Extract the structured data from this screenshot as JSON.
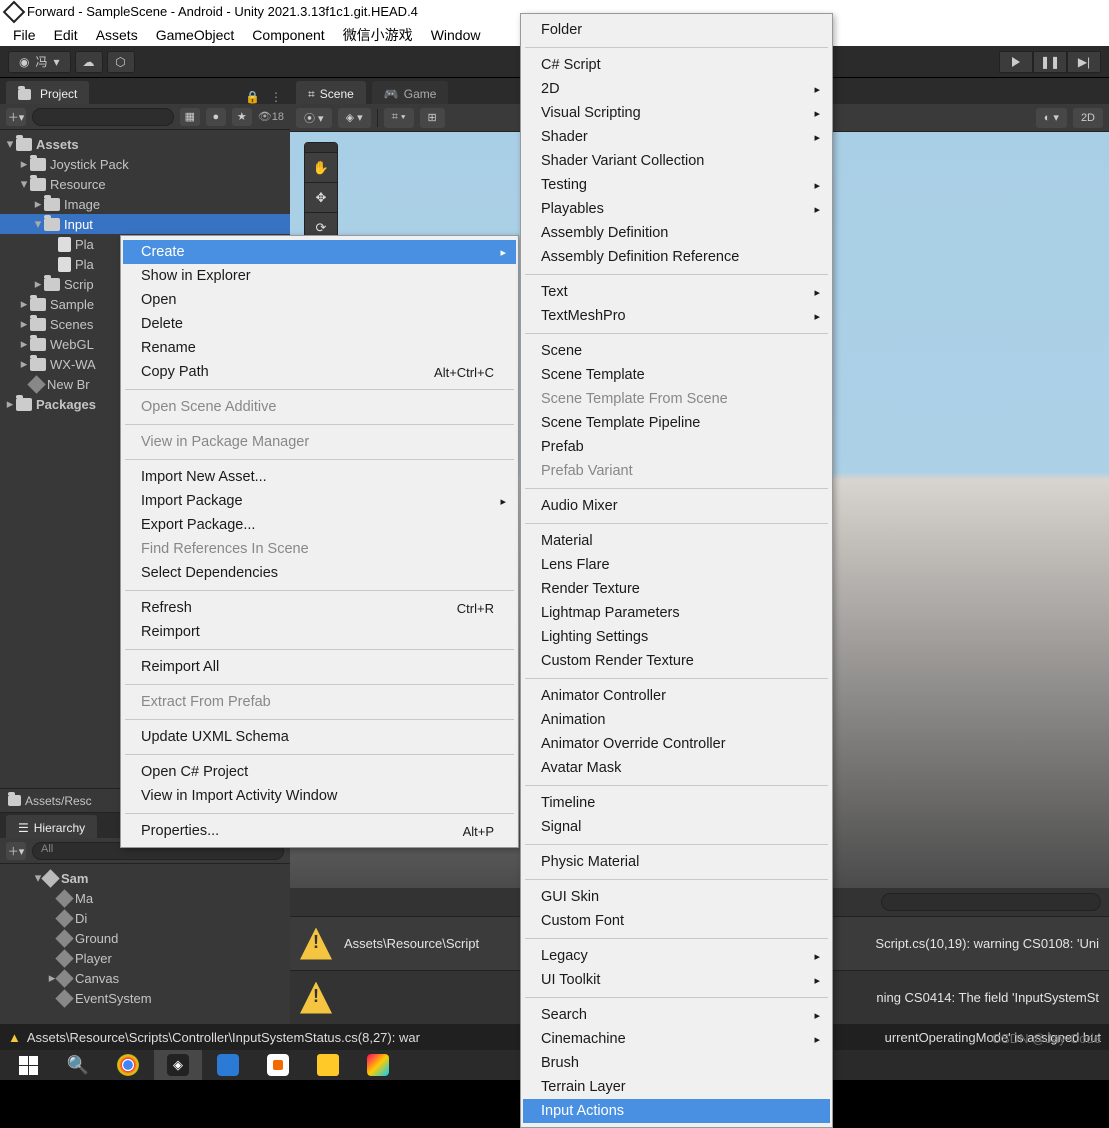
{
  "title": "Forward - SampleScene - Android - Unity 2021.3.13f1c1.git.HEAD.4",
  "menubar": [
    "File",
    "Edit",
    "Assets",
    "GameObject",
    "Component",
    "微信小游戏",
    "Window"
  ],
  "account": "冯",
  "play": {
    "play": "▶",
    "pause": "❚❚",
    "step": "▶|"
  },
  "projectTab": "Project",
  "visibilityCount": "18",
  "sceneTab": "Scene",
  "gameTab": "Game",
  "twoD": "2D",
  "tree": {
    "root": "Assets",
    "joystick": "Joystick Pack",
    "resource": "Resource",
    "image": "Image",
    "input": "Input",
    "pla1": "Pla",
    "pla2": "Pla",
    "scripts": "Scrip",
    "samples": "Sample",
    "scenes": "Scenes",
    "webgl": "WebGL",
    "wxwa": "WX-WA",
    "newbr": "New Br",
    "packages": "Packages"
  },
  "assetsPath": "Assets/Resc",
  "hierarchyTab": "Hierarchy",
  "hierarchySearch": "All",
  "hierarchy": {
    "scene": "Sam",
    "items": [
      "Ma",
      "Di",
      "Ground",
      "Player",
      "Canvas",
      "EventSystem"
    ]
  },
  "console": {
    "msg1": "Assets\\Resource\\Script",
    "msg1b": "Script.cs(10,19): warning CS0108: 'Uni",
    "msg2": "ning CS0414: The field 'InputSystemSt"
  },
  "status": "Assets\\Resource\\Scripts\\Controller\\InputSystemStatus.cs(8,27): war",
  "statusRight": "urrentOperatingMode' is assigned but",
  "watermark": "CSDN @Jay-Code",
  "ctx1": {
    "create": "Create",
    "showInExplorer": "Show in Explorer",
    "open": "Open",
    "del": "Delete",
    "rename": "Rename",
    "copyPath": "Copy Path",
    "copyPathSc": "Alt+Ctrl+C",
    "openSceneAdd": "Open Scene Additive",
    "viewInPkg": "View in Package Manager",
    "importAsset": "Import New Asset...",
    "importPackage": "Import Package",
    "exportPackage": "Export Package...",
    "findRefs": "Find References In Scene",
    "selectDeps": "Select Dependencies",
    "refresh": "Refresh",
    "refreshSc": "Ctrl+R",
    "reimport": "Reimport",
    "reimportAll": "Reimport All",
    "extract": "Extract From Prefab",
    "updateUxml": "Update UXML Schema",
    "openCs": "Open C# Project",
    "viewImport": "View in Import Activity Window",
    "properties": "Properties...",
    "propertiesSc": "Alt+P"
  },
  "ctx2": {
    "folder": "Folder",
    "csScript": "C# Script",
    "twoD": "2D",
    "visualScripting": "Visual Scripting",
    "shader": "Shader",
    "shaderVar": "Shader Variant Collection",
    "testing": "Testing",
    "playables": "Playables",
    "asmDef": "Assembly Definition",
    "asmDefRef": "Assembly Definition Reference",
    "text": "Text",
    "tmp": "TextMeshPro",
    "scene": "Scene",
    "sceneTpl": "Scene Template",
    "sceneTplFrom": "Scene Template From Scene",
    "sceneTplPipe": "Scene Template Pipeline",
    "prefab": "Prefab",
    "prefabVar": "Prefab Variant",
    "audioMixer": "Audio Mixer",
    "material": "Material",
    "lensFlare": "Lens Flare",
    "renderTex": "Render Texture",
    "lightmap": "Lightmap Parameters",
    "lighting": "Lighting Settings",
    "customRender": "Custom Render Texture",
    "animController": "Animator Controller",
    "animation": "Animation",
    "animOverride": "Animator Override Controller",
    "avatar": "Avatar Mask",
    "timeline": "Timeline",
    "signal": "Signal",
    "physic": "Physic Material",
    "guiSkin": "GUI Skin",
    "customFont": "Custom Font",
    "legacy": "Legacy",
    "uiToolkit": "UI Toolkit",
    "search": "Search",
    "cinemachine": "Cinemachine",
    "brush": "Brush",
    "terrain": "Terrain Layer",
    "inputActions": "Input Actions"
  }
}
